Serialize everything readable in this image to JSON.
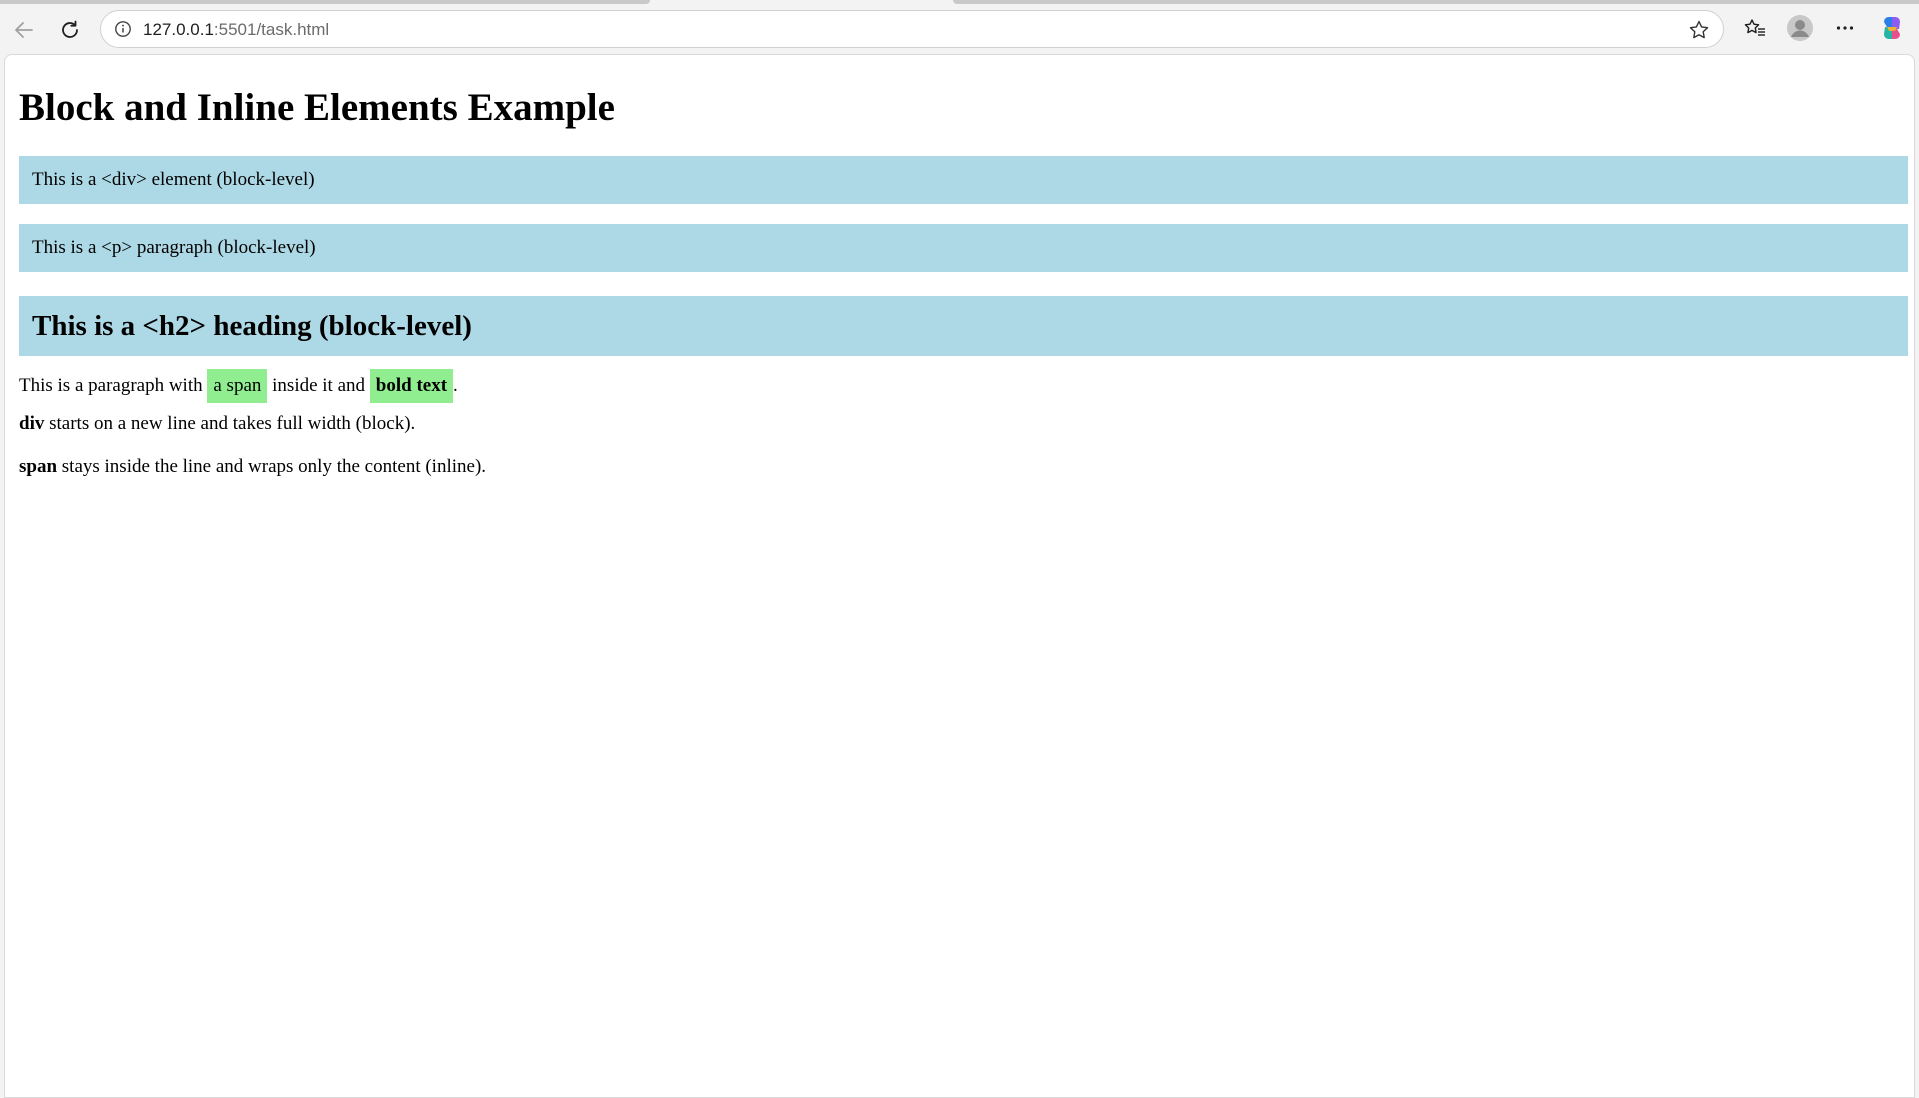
{
  "browser": {
    "url_host": "127.0.0.1",
    "url_rest": ":5501/task.html"
  },
  "page": {
    "title": "Block and Inline Elements Example",
    "div_text": "This is a <div> element (block-level)",
    "p_text": "This is a <p> paragraph (block-level)",
    "h2_text": "This is a <h2> heading (block-level)",
    "inline_para": {
      "before": "This is a paragraph with ",
      "span_text": "a span",
      "middle": " inside it and ",
      "bold_text": "bold text",
      "after": "."
    },
    "note_div": {
      "keyword": "div",
      "rest": " starts on a new line and takes full width (block)."
    },
    "note_span": {
      "keyword": "span",
      "rest": " stays inside the line and wraps only the content (inline)."
    }
  },
  "colors": {
    "block_bg": "#add8e6",
    "inline_highlight": "#90ee90"
  },
  "icons": {
    "back": "back-arrow-icon",
    "reload": "reload-icon",
    "info": "info-icon",
    "favorite": "star-icon",
    "favorites": "favorites-icon",
    "profile": "profile-icon",
    "menu": "more-icon",
    "copilot": "copilot-icon"
  }
}
